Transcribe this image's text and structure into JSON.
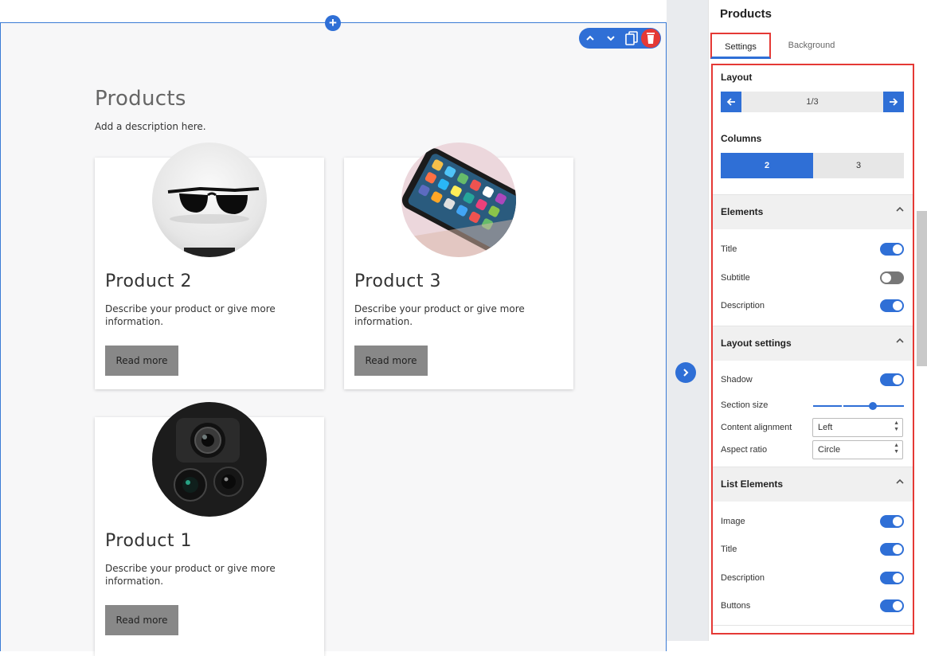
{
  "canvas": {
    "section_title": "Products",
    "section_description": "Add a description here.",
    "toolbar": {
      "add_icon": "plus-icon",
      "up_icon": "chevron-up-icon",
      "down_icon": "chevron-down-icon",
      "copy_icon": "copy-icon",
      "delete_icon": "trash-icon"
    },
    "products": [
      {
        "title": "Product 2",
        "description": "Describe your product or give more information.",
        "button": "Read more",
        "image": "sunglasses"
      },
      {
        "title": "Product 3",
        "description": "Describe your product or give more information.",
        "button": "Read more",
        "image": "smartphone"
      },
      {
        "title": "Product 1",
        "description": "Describe your product or give more information.",
        "button": "Read more",
        "image": "camera-lenses"
      }
    ]
  },
  "panel": {
    "title": "Products",
    "tabs": [
      {
        "label": "Settings",
        "active": true
      },
      {
        "label": "Background",
        "active": false
      }
    ],
    "layout": {
      "label": "Layout",
      "counter": "1/3"
    },
    "columns": {
      "label": "Columns",
      "options": [
        "2",
        "3"
      ],
      "selected": "2"
    },
    "elements": {
      "header": "Elements",
      "items": [
        {
          "label": "Title",
          "on": true
        },
        {
          "label": "Subtitle",
          "on": false
        },
        {
          "label": "Description",
          "on": true
        }
      ]
    },
    "layout_settings": {
      "header": "Layout settings",
      "shadow": {
        "label": "Shadow",
        "on": true
      },
      "section_size": {
        "label": "Section size",
        "value": 0.66
      },
      "content_alignment": {
        "label": "Content alignment",
        "value": "Left"
      },
      "aspect_ratio": {
        "label": "Aspect ratio",
        "value": "Circle"
      }
    },
    "list_elements": {
      "header": "List Elements",
      "items": [
        {
          "label": "Image",
          "on": true
        },
        {
          "label": "Title",
          "on": true
        },
        {
          "label": "Description",
          "on": true
        },
        {
          "label": "Buttons",
          "on": true
        }
      ]
    }
  },
  "colors": {
    "accent": "#2f6fd6",
    "highlight": "#e53935",
    "button_gray": "#888888"
  }
}
